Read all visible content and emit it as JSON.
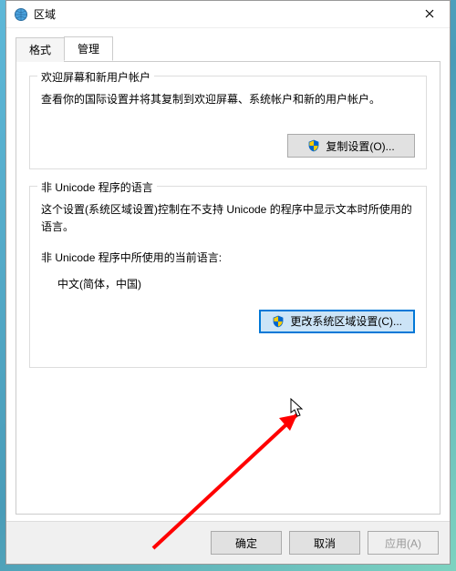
{
  "titlebar": {
    "title": "区域"
  },
  "tabs": {
    "format_label": "格式",
    "admin_label": "管理"
  },
  "group_welcome": {
    "legend": "欢迎屏幕和新用户帐户",
    "desc": "查看你的国际设置并将其复制到欢迎屏幕、系统帐户和新的用户帐户。",
    "copy_btn": "复制设置(O)..."
  },
  "group_nonunicode": {
    "legend": "非 Unicode 程序的语言",
    "desc": "这个设置(系统区域设置)控制在不支持 Unicode 的程序中显示文本时所使用的语言。",
    "current_label": "非 Unicode 程序中所使用的当前语言:",
    "current_value": "中文(简体，中国)",
    "change_btn": "更改系统区域设置(C)..."
  },
  "bottom": {
    "ok": "确定",
    "cancel": "取消",
    "apply": "应用(A)"
  }
}
